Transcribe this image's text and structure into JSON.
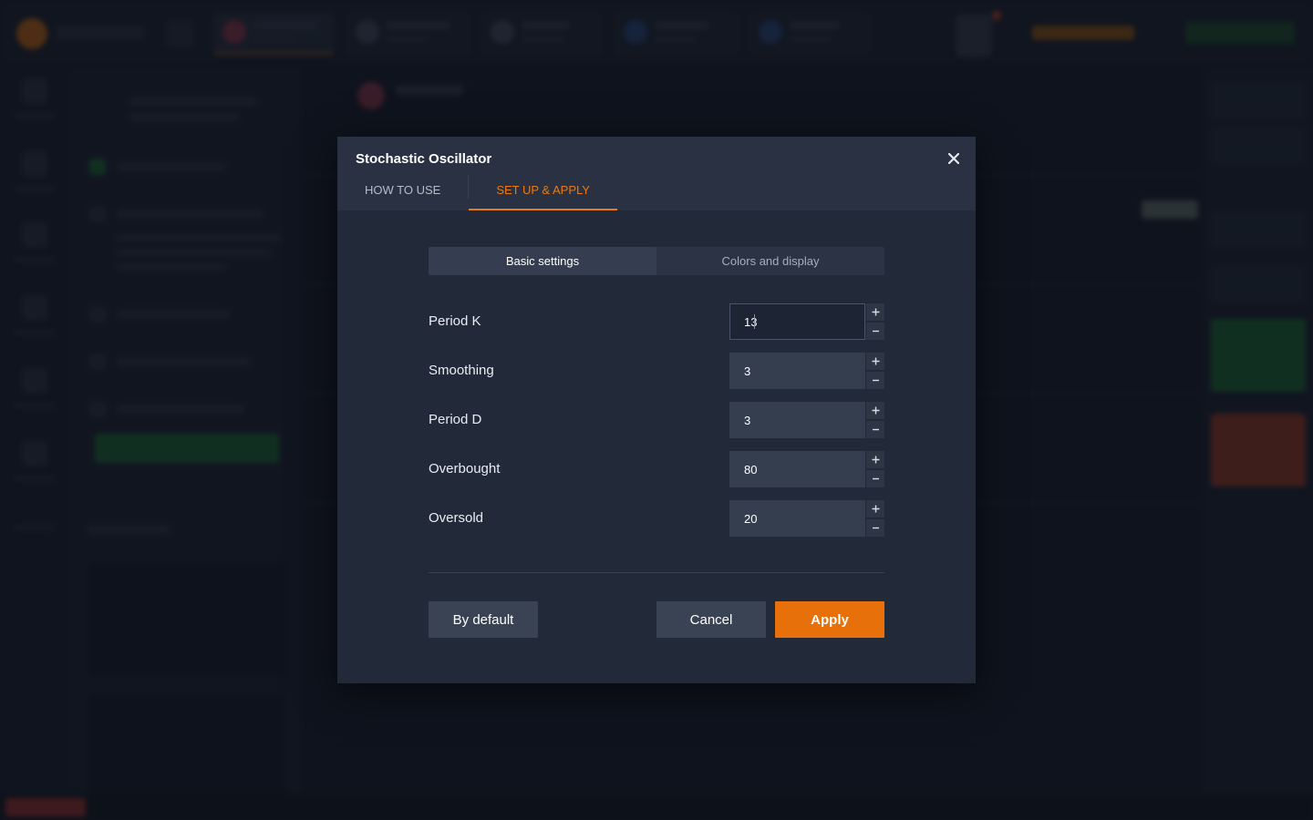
{
  "modal": {
    "title": "Stochastic Oscillator",
    "close_icon": "close-icon",
    "tabs": [
      {
        "label": "HOW TO USE",
        "active": false
      },
      {
        "label": "SET UP & APPLY",
        "active": true
      }
    ],
    "segments": [
      {
        "label": "Basic settings",
        "active": true
      },
      {
        "label": "Colors and display",
        "active": false
      }
    ],
    "settings": [
      {
        "label": "Period K",
        "value": "13",
        "focused": true
      },
      {
        "label": "Smoothing",
        "value": "3"
      },
      {
        "label": "Period D",
        "value": "3"
      },
      {
        "label": "Overbought",
        "value": "80"
      },
      {
        "label": "Oversold",
        "value": "20"
      }
    ],
    "buttons": {
      "by_default": "By default",
      "cancel": "Cancel",
      "apply": "Apply"
    }
  },
  "colors": {
    "accent": "#e8700a",
    "modal_bg": "#222a3a",
    "input_bg": "#353e4f"
  },
  "icons": {
    "stepper_up": "plus-icon",
    "stepper_down": "minus-icon"
  }
}
